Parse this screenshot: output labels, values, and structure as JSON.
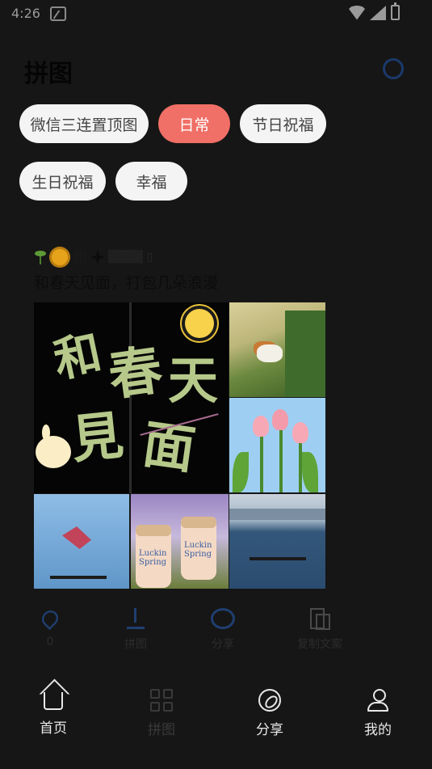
{
  "status_bar": {
    "time": "4:26"
  },
  "header": {
    "title": "拼图"
  },
  "categories": [
    {
      "label": "微信三连置顶图",
      "active": false
    },
    {
      "label": "日常",
      "active": true
    },
    {
      "label": "节日祝福",
      "active": false
    },
    {
      "label": "生日祝福",
      "active": false
    },
    {
      "label": "幸福",
      "active": false
    }
  ],
  "post": {
    "title_text": "和",
    "title_suffix": "▒▒▒▒ ▯",
    "subtitle": "和春天见面，打包几朵浪漫",
    "image_text": {
      "calligraphy": [
        "和",
        "春",
        "天",
        "見",
        "面"
      ],
      "drink_label": "Luckin Spring"
    }
  },
  "actions": [
    {
      "icon": "heart-icon",
      "label": "0"
    },
    {
      "icon": "puzzle-icon",
      "label": "拼图"
    },
    {
      "icon": "share-icon",
      "label": "分享"
    },
    {
      "icon": "copy-icon",
      "label": "复制文案"
    }
  ],
  "tabbar": [
    {
      "icon": "home-icon",
      "label": "首页",
      "active": true
    },
    {
      "icon": "grid-icon",
      "label": "拼图",
      "active": false
    },
    {
      "icon": "compass-icon",
      "label": "分享",
      "active": true
    },
    {
      "icon": "user-icon",
      "label": "我的",
      "active": true
    }
  ],
  "colors": {
    "background": "#161616",
    "chip_active": "#f06f66",
    "chip": "#f4f4f4",
    "icon_accent": "#1f3f70"
  }
}
